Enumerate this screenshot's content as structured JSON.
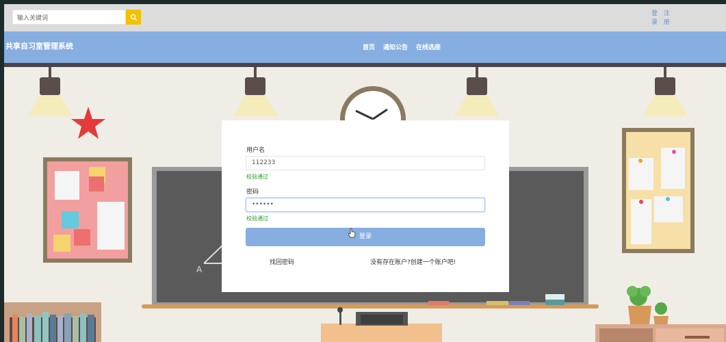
{
  "search": {
    "placeholder": "输入关键词"
  },
  "auth": {
    "login_chars": [
      "登",
      "录"
    ],
    "register_chars": [
      "注",
      "册"
    ]
  },
  "header": {
    "brand": "共享自习室管理系统",
    "nav": [
      "首页",
      "通知公告",
      "在线选座"
    ]
  },
  "login_form": {
    "username_label": "用户名",
    "username_value": "112233",
    "username_status": "校验通过",
    "password_label": "密码",
    "password_value": "••••••",
    "password_status": "校验通过",
    "submit_label": "登录",
    "forgot_link": "找回密码",
    "register_link": "没有存在账户?创建一个账户吧!"
  },
  "colors": {
    "nav_bg": "#87aee0",
    "topbar_bg": "#dcdcdc",
    "search_button": "#f2c200",
    "status_ok": "#22a022"
  },
  "icons": {
    "search": "search-icon"
  },
  "scene": {
    "chalkboard_letter": "A"
  }
}
